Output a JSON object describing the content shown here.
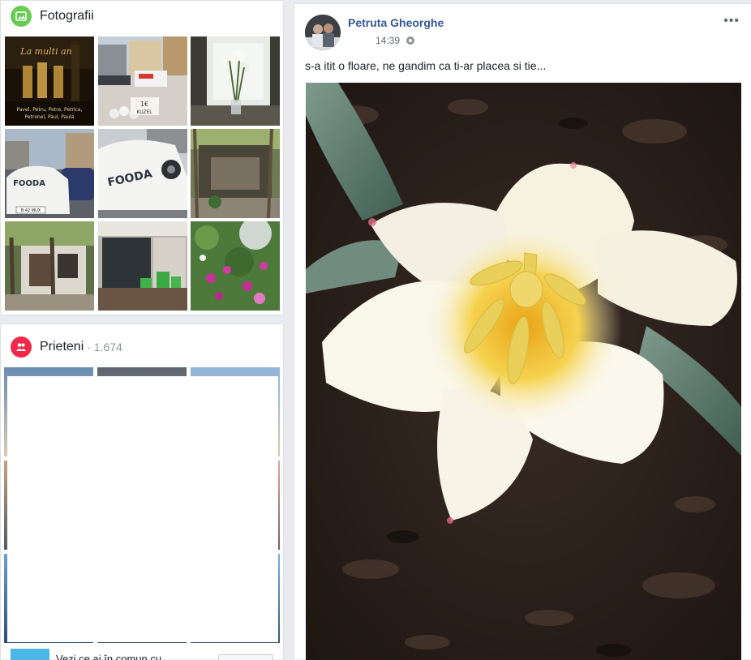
{
  "photos": {
    "title": "Fotografii",
    "icon": "photo-icon",
    "accent": "#6bcc55",
    "thumbs": [
      {
        "text1": "La multi ani!",
        "text2": "Pavel, Petru, Petre, Petrica,",
        "text3": "Petronel, Paul, Paula"
      },
      {
        "text1": "1€",
        "text2": "KUZEL"
      },
      {},
      {
        "text1": "FOODA",
        "text2": "B 42 MUX"
      },
      {
        "text1": "FOODA"
      },
      {},
      {},
      {},
      {}
    ]
  },
  "friends": {
    "title": "Prieteni",
    "count": "1.674",
    "icon": "friends-icon",
    "accent": "#f02849",
    "mutual_text": "Vezi ce ai în comun cu"
  },
  "post": {
    "author": "Petruta Gheorghe",
    "time": "14:39",
    "privacy_icon": "globe-icon",
    "more_label": "•••",
    "text": "s-a itit o floare, ne gandim ca ti-ar placea si tie...",
    "author_color": "#365899"
  }
}
